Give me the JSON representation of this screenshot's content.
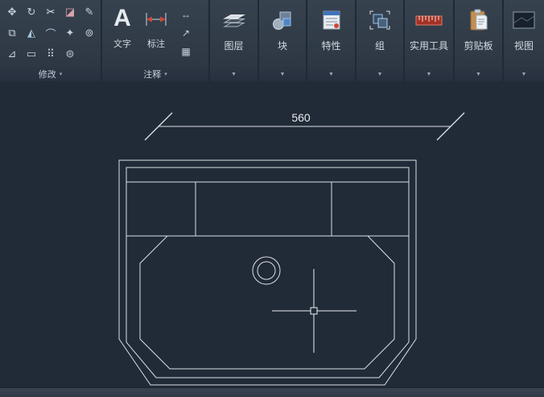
{
  "ribbon": {
    "modify": {
      "label": "修改",
      "expander": "▾",
      "tools": [
        {
          "name": "move",
          "glyph": "✥"
        },
        {
          "name": "rotate",
          "glyph": "↻"
        },
        {
          "name": "trim",
          "glyph": "✂"
        },
        {
          "name": "erase",
          "glyph": "◪"
        },
        {
          "name": "pencil",
          "glyph": "✎"
        },
        {
          "name": "copy",
          "glyph": "⧉"
        },
        {
          "name": "mirror",
          "glyph": "◭"
        },
        {
          "name": "fillet",
          "glyph": "⌒"
        },
        {
          "name": "explode",
          "glyph": "✦"
        },
        {
          "name": "offset",
          "glyph": "⊚"
        },
        {
          "name": "measure",
          "glyph": "⊿"
        },
        {
          "name": "scale",
          "glyph": "▭"
        },
        {
          "name": "array",
          "glyph": "⠿"
        },
        {
          "name": "align",
          "glyph": "⊜"
        }
      ]
    },
    "annotate": {
      "label": "注释",
      "expander": "▾",
      "text_tool": {
        "glyph": "A",
        "label": "文字"
      },
      "dim_tool": {
        "label": "标注"
      },
      "side_tools": [
        {
          "name": "dimension-style",
          "glyph": "↔"
        },
        {
          "name": "multileader",
          "glyph": "↗"
        },
        {
          "name": "table",
          "glyph": "▦"
        }
      ]
    },
    "big_panels": [
      {
        "id": "layers",
        "label": "图层",
        "expander": "▼"
      },
      {
        "id": "block",
        "label": "块",
        "expander": "▼"
      },
      {
        "id": "properties",
        "label": "特性",
        "expander": "▼"
      },
      {
        "id": "group",
        "label": "组",
        "expander": "▼"
      },
      {
        "id": "utilities",
        "label": "实用工具",
        "expander": "▼"
      },
      {
        "id": "clipboard",
        "label": "剪贴板",
        "expander": "▼"
      },
      {
        "id": "view",
        "label": "视图",
        "expander": "▼"
      }
    ]
  },
  "canvas": {
    "dimension_value": "560"
  },
  "colors": {
    "ribbon_bg": "#28313e",
    "panel_bg": "#37424f",
    "canvas_bg": "#212a37",
    "line": "#dde1e6",
    "label_text": "#c6cdd7"
  }
}
